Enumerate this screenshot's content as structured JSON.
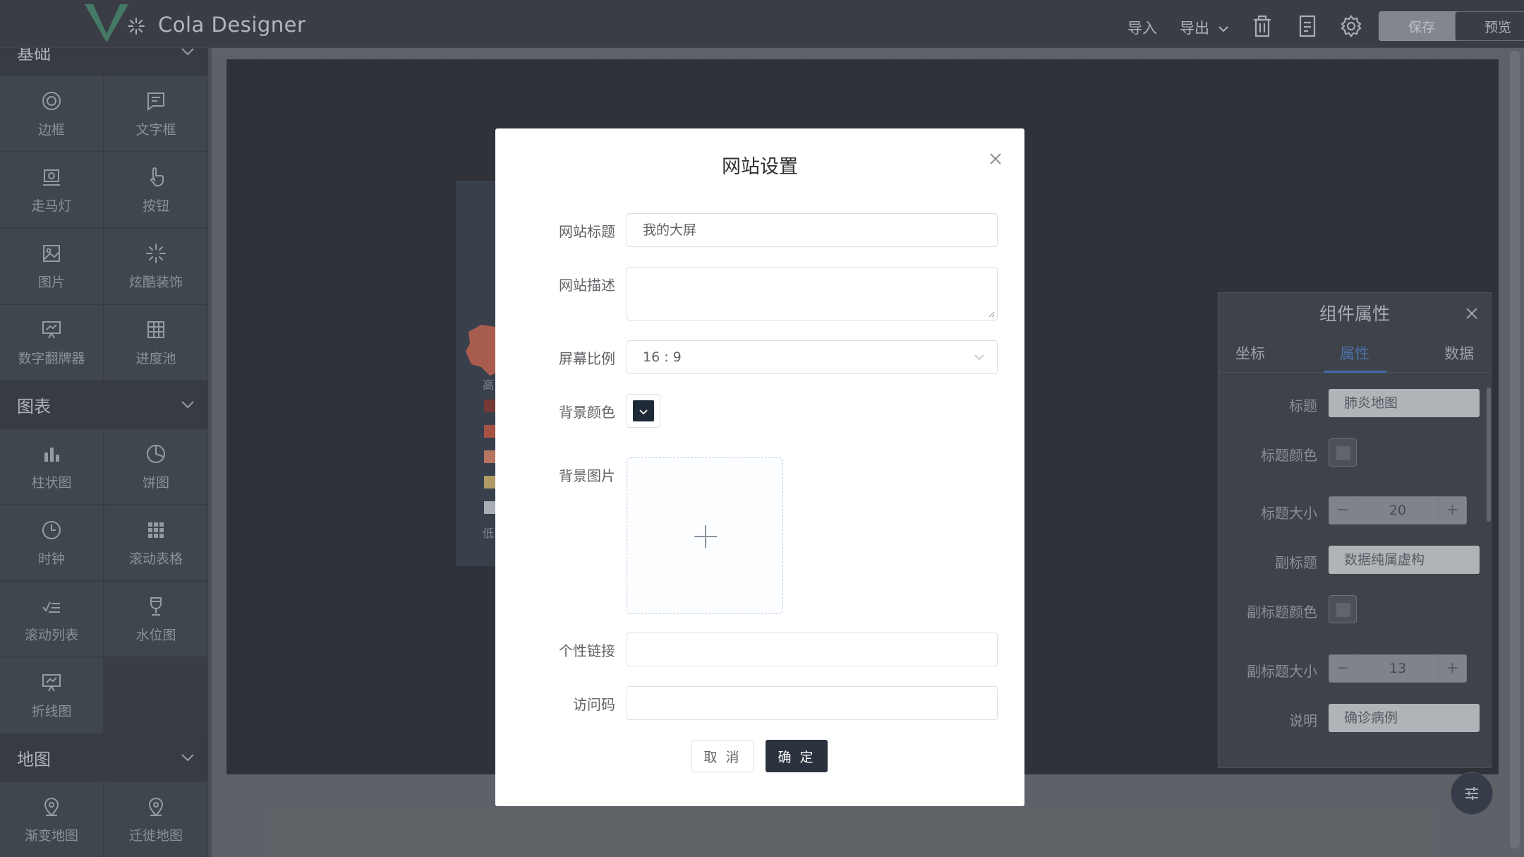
{
  "app": {
    "title": "Cola Designer",
    "accent": "#3c8f6a"
  },
  "header": {
    "import_label": "导入",
    "export_label": "导出",
    "save_label": "保存",
    "preview_label": "预览",
    "icons": [
      "trash-icon",
      "document-icon",
      "gear-icon"
    ]
  },
  "sidebar": {
    "sections": [
      {
        "title": "基础",
        "items": [
          {
            "label": "边框",
            "icon": "border-icon"
          },
          {
            "label": "文字框",
            "icon": "textbox-icon"
          },
          {
            "label": "走马灯",
            "icon": "carousel-icon"
          },
          {
            "label": "按钮",
            "icon": "pointer-icon"
          },
          {
            "label": "图片",
            "icon": "image-icon"
          },
          {
            "label": "炫酷装饰",
            "icon": "sparkle-icon"
          },
          {
            "label": "数字翻牌器",
            "icon": "number-board-icon"
          },
          {
            "label": "进度池",
            "icon": "grid-icon"
          }
        ]
      },
      {
        "title": "图表",
        "items": [
          {
            "label": "柱状图",
            "icon": "bar-chart-icon"
          },
          {
            "label": "饼图",
            "icon": "pie-chart-icon"
          },
          {
            "label": "时钟",
            "icon": "clock-icon"
          },
          {
            "label": "滚动表格",
            "icon": "table-icon"
          },
          {
            "label": "滚动列表",
            "icon": "list-icon"
          },
          {
            "label": "水位图",
            "icon": "cup-icon"
          },
          {
            "label": "折线图",
            "icon": "line-chart-icon"
          }
        ]
      },
      {
        "title": "地图",
        "items": [
          {
            "label": "渐变地图",
            "icon": "map-pin-icon"
          },
          {
            "label": "迁徙地图",
            "icon": "map-pin-icon"
          }
        ]
      }
    ]
  },
  "canvas": {
    "legend_colors": [
      "#7a1b12",
      "#c8432a",
      "#e0795a",
      "#d6b15a",
      "#c9ced6"
    ],
    "legend_high": "高",
    "legend_low": "低"
  },
  "properties_panel": {
    "title": "组件属性",
    "tabs": [
      "坐标",
      "属性",
      "数据"
    ],
    "active_tab": "属性",
    "fields": {
      "title_label": "标题",
      "title_value": "肺炎地图",
      "title_color_label": "标题颜色",
      "title_size_label": "标题大小",
      "title_size_value": "20",
      "subtitle_label": "副标题",
      "subtitle_value": "数据纯属虚构",
      "subtitle_color_label": "副标题颜色",
      "subtitle_size_label": "副标题大小",
      "subtitle_size_value": "13",
      "desc_label": "说明",
      "desc_value": "确诊病例"
    }
  },
  "modal": {
    "title": "网站设置",
    "site_title_label": "网站标题",
    "site_title_value": "我的大屏",
    "site_desc_label": "网站描述",
    "site_desc_value": "",
    "ratio_label": "屏幕比例",
    "ratio_value": "16 : 9",
    "bg_color_label": "背景颜色",
    "bg_color_value": "#1f2a38",
    "bg_image_label": "背景图片",
    "link_label": "个性链接",
    "link_value": "",
    "access_code_label": "访问码",
    "access_code_value": "",
    "cancel_label": "取 消",
    "ok_label": "确 定"
  }
}
